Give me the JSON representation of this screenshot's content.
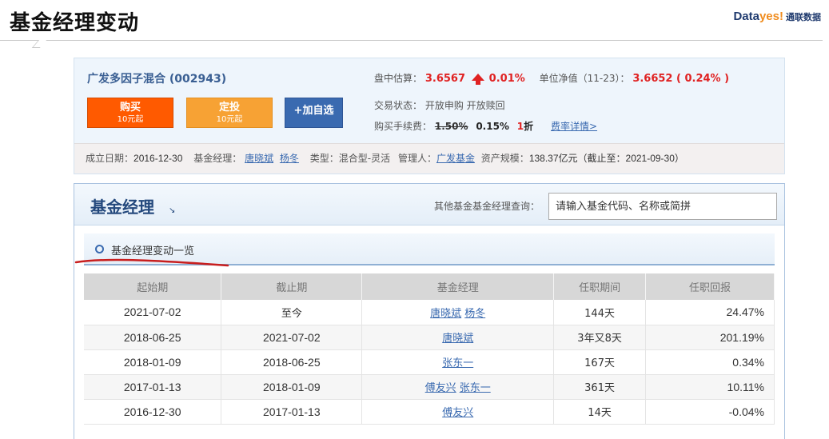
{
  "slide": {
    "title": "基金经理变动"
  },
  "brand": {
    "prefix": "Data",
    "accent": "yes!",
    "cn": "通联数据"
  },
  "fund": {
    "name": "广发多因子混合 (002943)",
    "buy_label": "购买",
    "buy_sub": "10元起",
    "plan_label": "定投",
    "plan_sub": "10元起",
    "watch_label": "+加自选",
    "est_label": "盘中估算：",
    "est_value": "3.6567",
    "est_change": "0.01%",
    "nav_label": "单位净值（11-23）：",
    "nav_value": "3.6652 ( 0.24% )",
    "trade_status": "交易状态：  开放申购   开放赎回",
    "fee_label": "购买手续费：",
    "fee_original": "1.50%",
    "fee_current": "0.15%",
    "fee_discount_num": "1",
    "fee_discount_unit": "折",
    "fee_link": "费率详情>",
    "meta": {
      "established_label": "成立日期：",
      "established": "2016-12-30",
      "manager_label": "基金经理：",
      "managers": [
        "唐晓斌",
        "杨冬"
      ],
      "type_label": "类型：混合型-灵活",
      "company_label": "管理人：",
      "company": "广发基金",
      "size_label": "资产规模：",
      "size": "138.37亿元（截止至：2021-09-30）"
    }
  },
  "manager_panel": {
    "title": "基金经理",
    "title_arrow": "↘",
    "query_label": "其他基金基金经理查询：",
    "query_placeholder": "请输入基金代码、名称或简拼",
    "section_title": "基金经理变动一览",
    "columns": [
      "起始期",
      "截止期",
      "基金经理",
      "任职期间",
      "任职回报"
    ],
    "rows": [
      {
        "start": "2021-07-02",
        "end": "至今",
        "managers": [
          "唐晓斌",
          "杨冬"
        ],
        "duration": "144天",
        "return": "24.47%",
        "sign": "pos"
      },
      {
        "start": "2018-06-25",
        "end": "2021-07-02",
        "managers": [
          "唐晓斌"
        ],
        "duration": "3年又8天",
        "return": "201.19%",
        "sign": "pos"
      },
      {
        "start": "2018-01-09",
        "end": "2018-06-25",
        "managers": [
          "张东一"
        ],
        "duration": "167天",
        "return": "0.34%",
        "sign": "pos"
      },
      {
        "start": "2017-01-13",
        "end": "2018-01-09",
        "managers": [
          "傅友兴",
          "张东一"
        ],
        "duration": "361天",
        "return": "10.11%",
        "sign": "pos"
      },
      {
        "start": "2016-12-30",
        "end": "2017-01-13",
        "managers": [
          "傅友兴"
        ],
        "duration": "14天",
        "return": "-0.04%",
        "sign": "neg"
      }
    ]
  },
  "colors": {
    "buy": "#ff5a00",
    "plan": "#f7a234",
    "watch": "#3a6ab0",
    "positive": "#d42020",
    "negative": "#2a9a2a",
    "annotation": "#c81e1e"
  }
}
